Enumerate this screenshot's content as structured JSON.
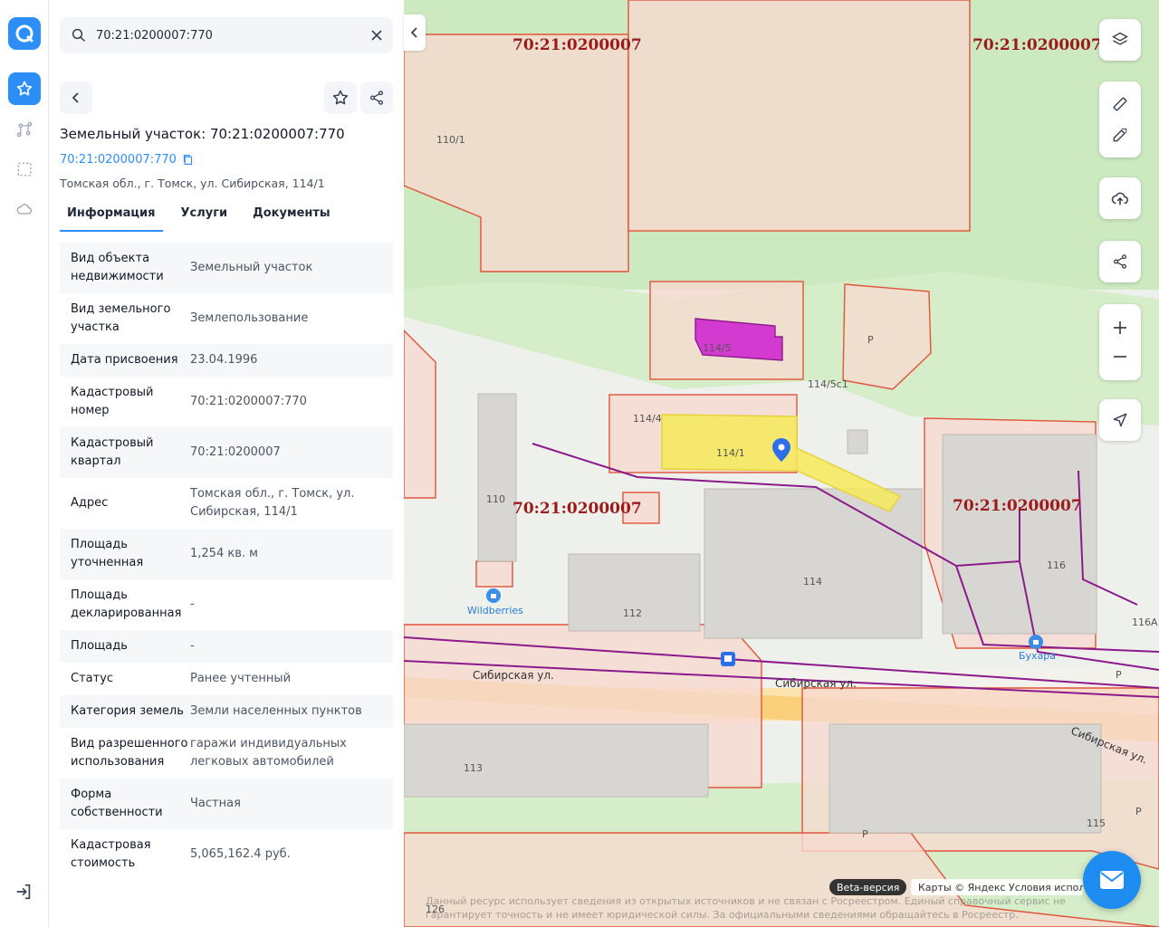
{
  "search": {
    "query": "70:21:0200007:770"
  },
  "object": {
    "title": "Земельный участок: 70:21:0200007:770",
    "cad_link": "70:21:0200007:770",
    "address": "Томская обл., г. Томск, ул. Сибирская, 114/1"
  },
  "tabs": [
    "Информация",
    "Услуги",
    "Документы"
  ],
  "rows": [
    {
      "k": "Вид объекта недвижимости",
      "v": "Земельный участок"
    },
    {
      "k": "Вид земельного участка",
      "v": "Землепользование"
    },
    {
      "k": "Дата присвоения",
      "v": "23.04.1996"
    },
    {
      "k": "Кадастровый номер",
      "v": "70:21:0200007:770"
    },
    {
      "k": "Кадастровый квартал",
      "v": "70:21:0200007"
    },
    {
      "k": "Адрес",
      "v": "Томская обл., г. Томск, ул. Сибирская, 114/1"
    },
    {
      "k": "Площадь уточненная",
      "v": "1,254 кв. м"
    },
    {
      "k": "Площадь декларированная",
      "v": "-"
    },
    {
      "k": "Площадь",
      "v": "-"
    },
    {
      "k": "Статус",
      "v": "Ранее учтенный"
    },
    {
      "k": "Категория земель",
      "v": "Земли населенных пунктов"
    },
    {
      "k": "Вид разрешенного использования",
      "v": "гаражи индивидуальных легковых автомобилей"
    },
    {
      "k": "Форма собственности",
      "v": "Частная"
    },
    {
      "k": "Кадастровая стоимость",
      "v": "5,065,162.4 руб."
    }
  ],
  "map": {
    "quarter_labels": [
      "70:21:0200007",
      "70:21:0200007",
      "70:21:0200007",
      "70:21:0200007"
    ],
    "building_labels": [
      "110/1",
      "114/5",
      "114/5с1",
      "114/4",
      "114/1",
      "110",
      "112",
      "114",
      "116",
      "116А",
      "113",
      "115",
      "126",
      "P",
      "P",
      "P",
      "P"
    ],
    "streets": [
      "Сибирская ул.",
      "Сибирская ул.",
      "Сибирская ул."
    ],
    "pois": [
      "Wildberries",
      "Бухара"
    ],
    "beta": "Beta-версия",
    "copyright": "Карты © Яндекс   Условия использования",
    "disclaimer": "Данный ресурс использует сведения из открытых источников и не связан с Росреестром. Единый справочный сервис не гарантирует точность и не имеет юридической силы. За официальными сведениями обращайтесь в Росреестр."
  },
  "colors": {
    "accent": "#2d8ef7",
    "parcel_border": "#e0543a",
    "selected_parcel": "#f5ea5a"
  }
}
